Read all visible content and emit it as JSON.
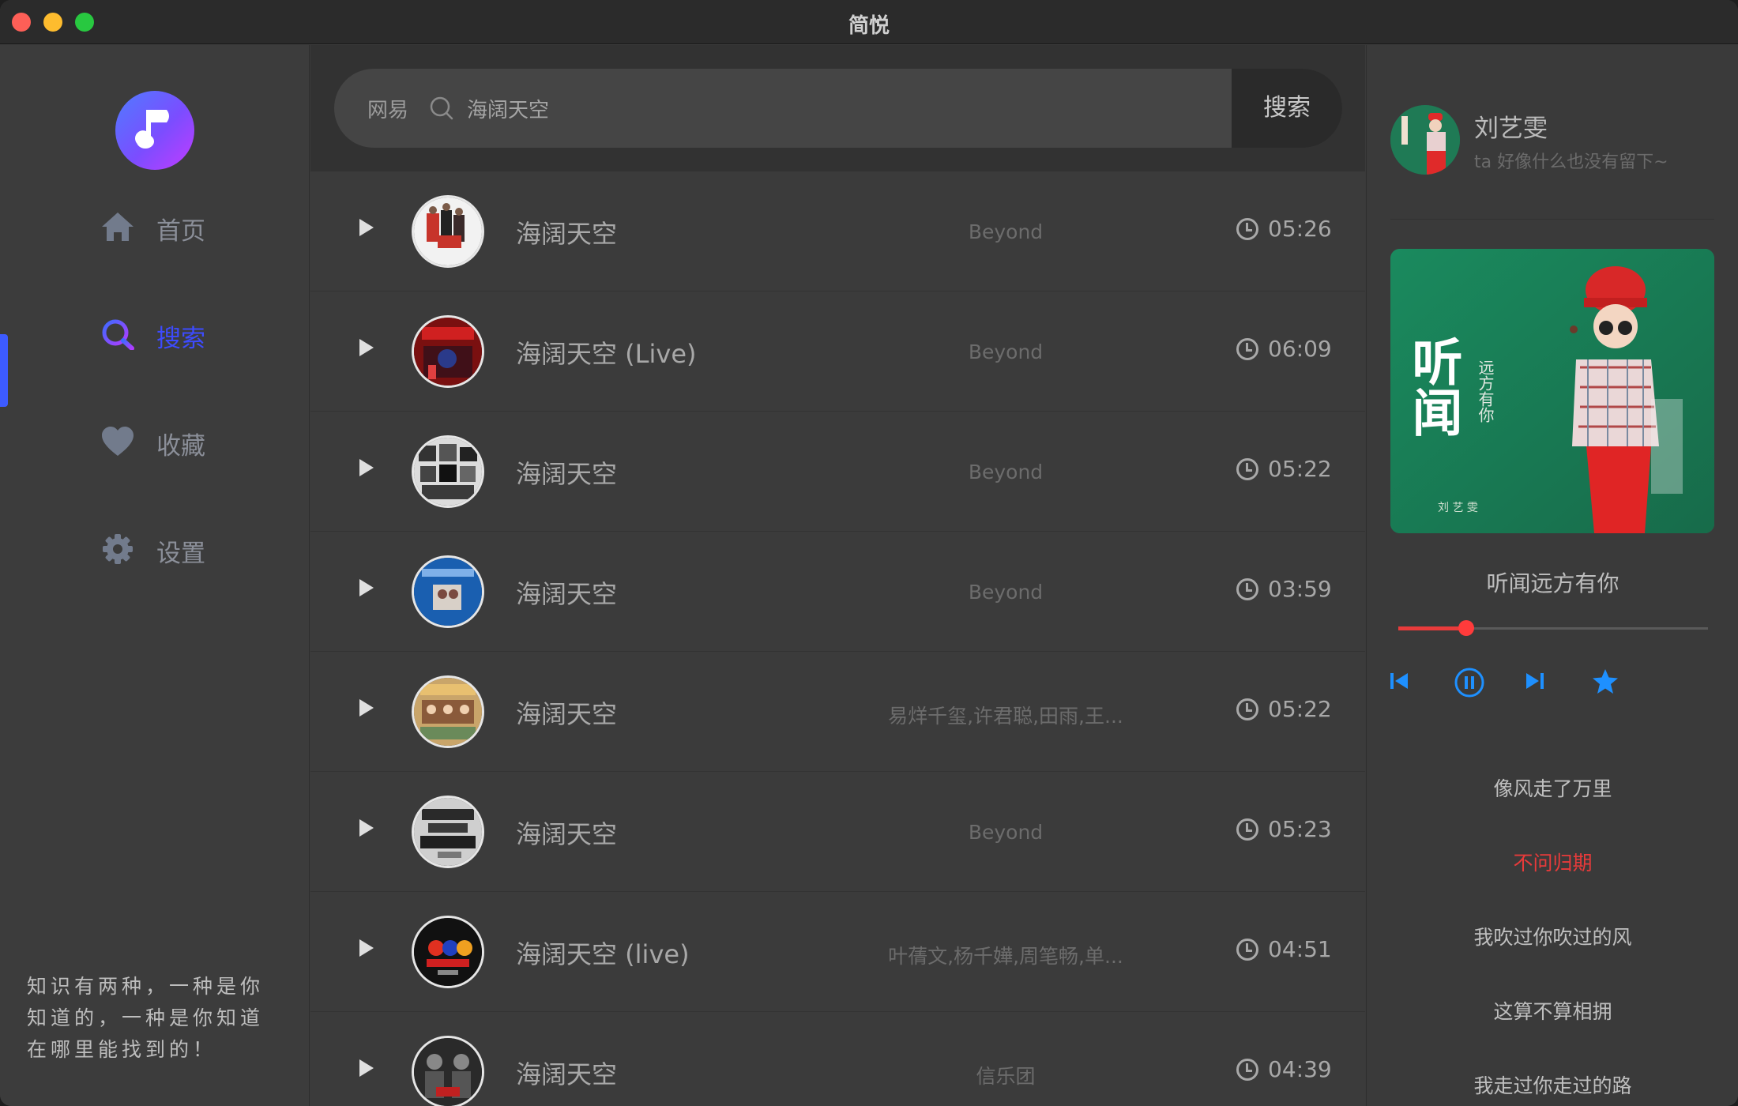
{
  "window": {
    "title": "简悦"
  },
  "sidebar": {
    "items": [
      {
        "label": "首页",
        "icon": "home-icon"
      },
      {
        "label": "搜索",
        "icon": "search-icon",
        "active": true
      },
      {
        "label": "收藏",
        "icon": "heart-icon"
      },
      {
        "label": "设置",
        "icon": "gear-icon"
      }
    ],
    "quote": "知识有两种，一种是你知道的，一种是你知道在哪里能找到的！"
  },
  "search": {
    "source": "网易",
    "query": "海阔天空",
    "button_label": "搜索"
  },
  "results": [
    {
      "name": "海阔天空",
      "artist": "Beyond",
      "duration": "05:26"
    },
    {
      "name": "海阔天空 (Live)",
      "artist": "Beyond",
      "duration": "06:09"
    },
    {
      "name": "海阔天空",
      "artist": "Beyond",
      "duration": "05:22"
    },
    {
      "name": "海阔天空",
      "artist": "Beyond",
      "duration": "03:59"
    },
    {
      "name": "海阔天空",
      "artist": "易烊千玺,许君聪,田雨,王...",
      "duration": "05:22"
    },
    {
      "name": "海阔天空",
      "artist": "Beyond",
      "duration": "05:23"
    },
    {
      "name": "海阔天空 (live)",
      "artist": "叶蒨文,杨千嬅,周笔畅,单...",
      "duration": "04:51"
    },
    {
      "name": "海阔天空",
      "artist": "信乐团",
      "duration": "04:39"
    }
  ],
  "player": {
    "user_name": "刘艺雯",
    "user_signature": "ta 好像什么也没有留下~",
    "album_art_title": "听闻",
    "album_art_subtitle": "远方有你",
    "album_art_artist": "刘 艺   雯",
    "song_title": "听闻远方有你",
    "progress": 0.22,
    "accent_color": "#1e90ff",
    "progress_color": "#e93b3b",
    "lyrics": [
      {
        "text": "像风走了万里",
        "active": false
      },
      {
        "text": "不问归期",
        "active": true
      },
      {
        "text": "我吹过你吹过的风",
        "active": false
      },
      {
        "text": "这算不算相拥",
        "active": false
      },
      {
        "text": "我走过你走过的路",
        "active": false
      }
    ]
  }
}
